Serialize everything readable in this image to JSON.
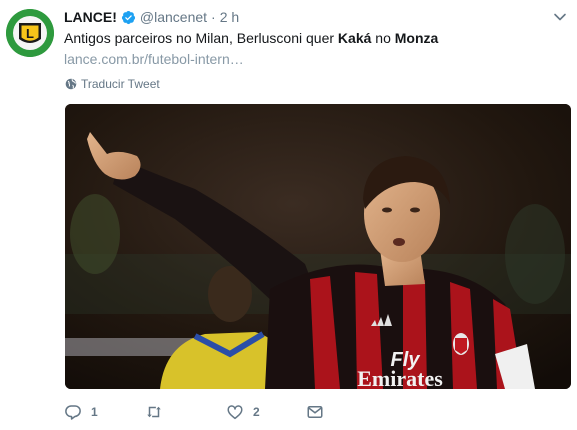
{
  "tweet": {
    "author_name": "LANCE!",
    "handle": "@lancenet",
    "separator": "·",
    "time": "2 h",
    "text_parts": {
      "p1": "Antigos parceiros no Milan, Berlusconi quer ",
      "p2": "Kaká",
      "p3": " no ",
      "p4": "Monza"
    },
    "link": "lance.com.br/futebol-intern…",
    "translate_label": "Traducir Tweet",
    "avatar_letter": "L",
    "media": {
      "shirt_text_line1": "Fly",
      "shirt_text_line2": "Emirates"
    },
    "actions": {
      "reply_count": "1",
      "retweet_count": "",
      "like_count": "2"
    },
    "colors": {
      "brand_green": "#2e9a3e",
      "verified_blue": "#1da1f2",
      "muted": "#657786"
    },
    "icons": [
      "verified-icon",
      "chevron-down-icon",
      "globe-icon",
      "reply-icon",
      "retweet-icon",
      "like-icon",
      "message-icon"
    ]
  }
}
